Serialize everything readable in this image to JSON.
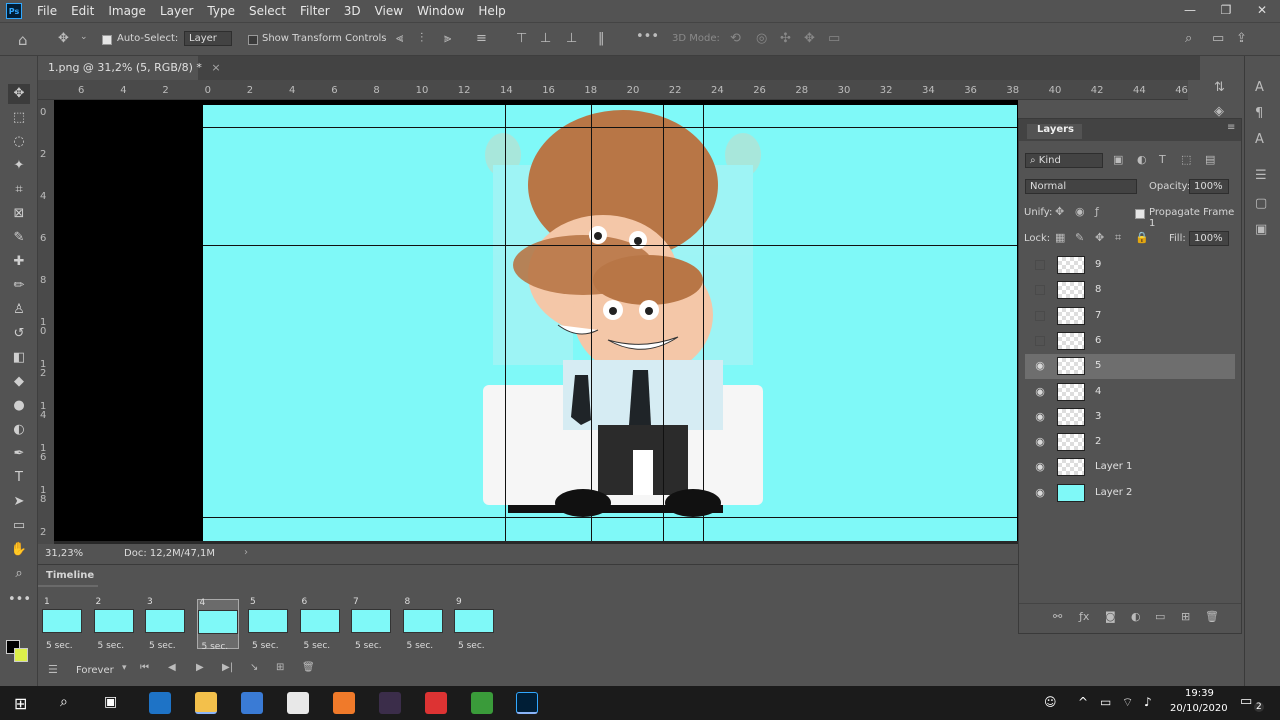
{
  "menu": {
    "items": [
      "File",
      "Edit",
      "Image",
      "Layer",
      "Type",
      "Select",
      "Filter",
      "3D",
      "View",
      "Window",
      "Help"
    ],
    "logo": "Ps"
  },
  "window_controls": {
    "minimize": "—",
    "restore": "❐",
    "close": "✕"
  },
  "options": {
    "auto_select_label": "Auto-Select:",
    "auto_select_target": "Layer",
    "show_transform_label": "Show Transform Controls",
    "mode_3d": "3D Mode:"
  },
  "document": {
    "tab_title": "1.png @ 31,2% (5, RGB/8) *"
  },
  "ruler_h": [
    "6",
    "4",
    "2",
    "0",
    "2",
    "4",
    "6",
    "8",
    "10",
    "12",
    "14",
    "16",
    "18",
    "20",
    "22",
    "24",
    "26",
    "28",
    "30",
    "32",
    "34",
    "36",
    "38",
    "40",
    "42",
    "44",
    "46"
  ],
  "ruler_v": [
    "0",
    "2",
    "4",
    "6",
    "8",
    "1 0",
    "1 2",
    "1 4",
    "1 6",
    "1 8",
    "2"
  ],
  "status": {
    "zoom": "31,23%",
    "doc": "Doc: 12,2M/47,1M"
  },
  "timeline": {
    "title": "Timeline",
    "loop": "Forever",
    "frames": [
      {
        "num": "1",
        "duration": "5 sec."
      },
      {
        "num": "2",
        "duration": "5 sec."
      },
      {
        "num": "3",
        "duration": "5 sec."
      },
      {
        "num": "4",
        "duration": "5 sec."
      },
      {
        "num": "5",
        "duration": "5 sec."
      },
      {
        "num": "6",
        "duration": "5 sec."
      },
      {
        "num": "7",
        "duration": "5 sec."
      },
      {
        "num": "8",
        "duration": "5 sec."
      },
      {
        "num": "9",
        "duration": "5 sec."
      }
    ],
    "selected_frame": "4"
  },
  "layers_panel": {
    "title": "Layers",
    "filter_kind": "Kind",
    "blend_mode": "Normal",
    "opacity_label": "Opacity:",
    "opacity_value": "100%",
    "unify_label": "Unify:",
    "propagate_label": "Propagate Frame 1",
    "lock_label": "Lock:",
    "fill_label": "Fill:",
    "fill_value": "100%",
    "layers": [
      {
        "name": "9",
        "visible": false
      },
      {
        "name": "8",
        "visible": false
      },
      {
        "name": "7",
        "visible": false
      },
      {
        "name": "6",
        "visible": false
      },
      {
        "name": "5",
        "visible": true,
        "selected": true
      },
      {
        "name": "4",
        "visible": true
      },
      {
        "name": "3",
        "visible": true
      },
      {
        "name": "2",
        "visible": true
      },
      {
        "name": "Layer 1",
        "visible": true
      },
      {
        "name": "Layer 2",
        "visible": true
      }
    ]
  },
  "taskbar": {
    "time": "19:39",
    "date": "20/10/2020",
    "notifications": "2"
  },
  "colors": {
    "canvas_bg": "#7ff9f8",
    "ui_bg": "#535353",
    "ps_accent": "#31a8ff"
  }
}
